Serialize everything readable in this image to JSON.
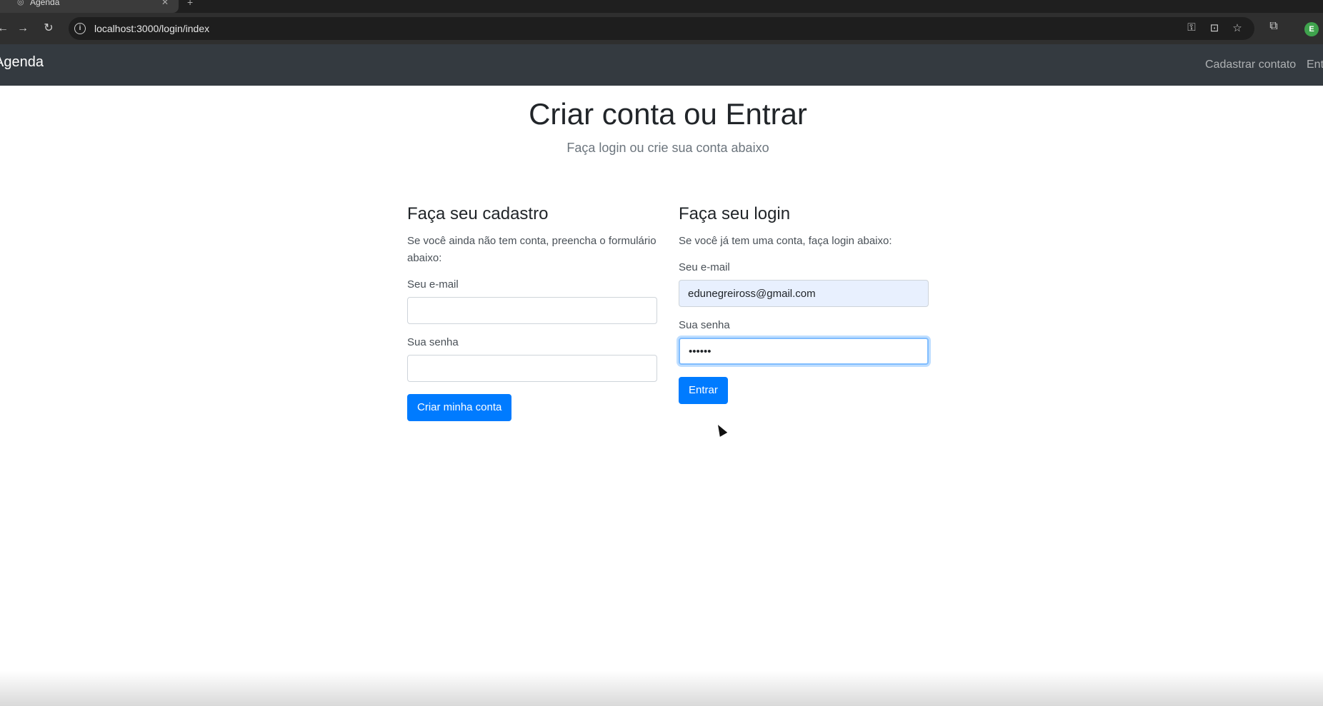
{
  "browser": {
    "tab_title": "Agenda",
    "tab_favicon": "globe-icon",
    "url": "localhost:3000/login/index",
    "profile_initial": "E"
  },
  "navbar": {
    "brand": "Agenda",
    "links": [
      "Cadastrar contato",
      "Entrar"
    ]
  },
  "header": {
    "title": "Criar conta ou Entrar",
    "subtitle": "Faça login ou crie sua conta abaixo"
  },
  "register": {
    "heading": "Faça seu cadastro",
    "description": "Se você ainda não tem conta, preencha o formulário abaixo:",
    "email_label": "Seu e-mail",
    "email_value": "",
    "password_label": "Sua senha",
    "password_value": "",
    "submit_label": "Criar minha conta"
  },
  "login": {
    "heading": "Faça seu login",
    "description": "Se você já tem uma conta, faça login abaixo:",
    "email_label": "Seu e-mail",
    "email_value": "edunegreiross@gmail.com",
    "password_label": "Sua senha",
    "password_value": "••••••",
    "submit_label": "Entrar"
  },
  "colors": {
    "navbar_bg": "#343a40",
    "primary": "#007bff",
    "autofill_bg": "#e8f0fe"
  }
}
